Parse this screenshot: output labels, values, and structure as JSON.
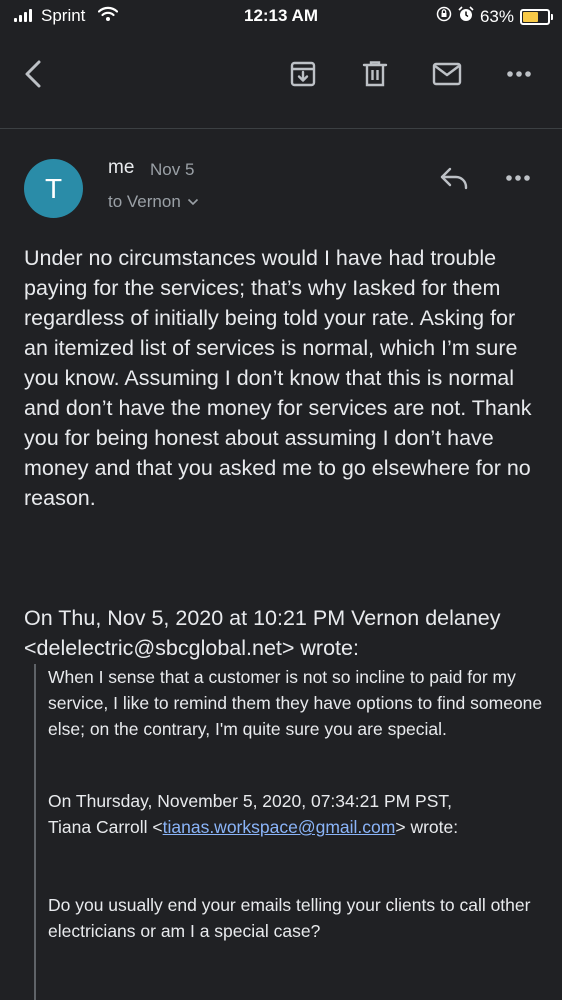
{
  "status_bar": {
    "carrier": "Sprint",
    "time": "12:13 AM",
    "battery_percent": "63%",
    "battery_level": 0.63,
    "icons": [
      "signal-bars-icon",
      "wifi-icon",
      "orientation-lock-icon",
      "alarm-icon",
      "battery-icon"
    ]
  },
  "toolbar": {
    "icons": [
      "back-arrow-icon",
      "archive-icon",
      "trash-icon",
      "mail-icon",
      "more-horizontal-icon"
    ]
  },
  "message": {
    "avatar_letter": "T",
    "avatar_color": "#2a8ca8",
    "sender": "me",
    "date": "Nov 5",
    "recipient": "to Vernon",
    "body": "Under no circumstances would I have had trouble paying for the services; that’s why Iasked for them regardless of initially being told your rate. Asking for an itemized list of services is normal, which I’m sure you know. Assuming I don’t know that this is normal and don’t have the money for services are not. Thank you for being honest about assuming I don’t have money and that you asked me to go elsewhere for no reason."
  },
  "quoted": {
    "header": "On Thu, Nov 5, 2020 at 10:21 PM Vernon delaney <delelectric@sbcglobal.net> wrote:",
    "reply_text": "When I sense that a customer is not so incline to paid for my service, I like to remind them they have options to find someone else; on the contrary, I'm quite sure you are special.",
    "nested_header_line1": "On Thursday, November 5, 2020, 07:34:21 PM PST,",
    "nested_header_name": "Tiana Carroll",
    "nested_email": "tianas.workspace@gmail.com",
    "nested_wrote": "wrote:",
    "nested_text": "Do you usually end your emails telling your clients to call other electricians or am I a special case?",
    "link_color": "#8ab4f8"
  }
}
